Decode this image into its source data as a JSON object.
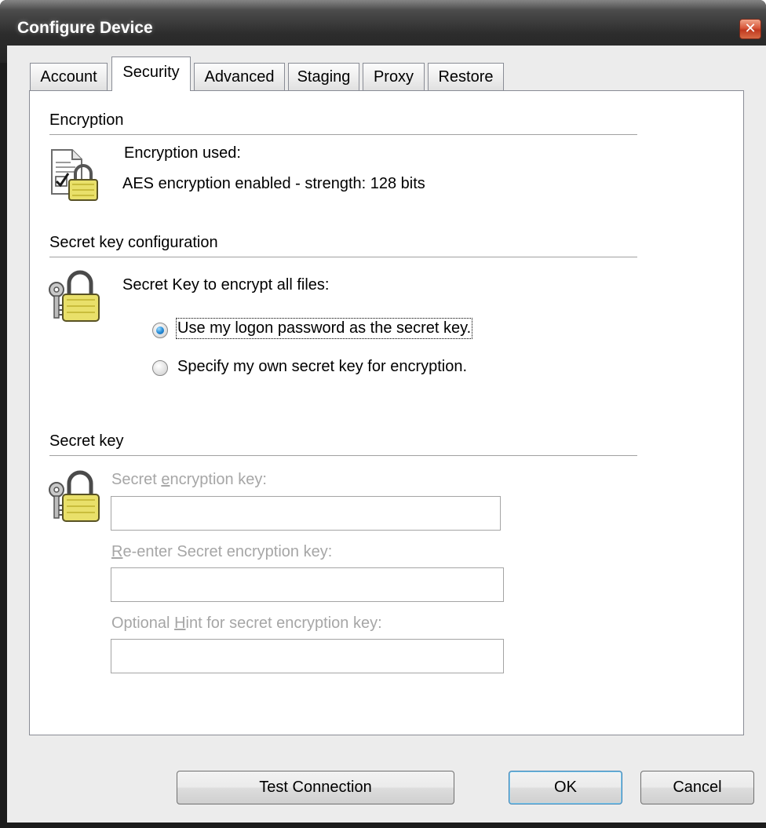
{
  "window": {
    "title": "Configure Device",
    "close_glyph": "✕"
  },
  "tabs": [
    {
      "label": "Account",
      "active": false
    },
    {
      "label": "Security",
      "active": true
    },
    {
      "label": "Advanced",
      "active": false
    },
    {
      "label": "Staging",
      "active": false
    },
    {
      "label": "Proxy",
      "active": false
    },
    {
      "label": "Restore",
      "active": false
    }
  ],
  "encryption": {
    "header": "Encryption",
    "icon": "document-lock-icon",
    "used_label": "Encryption used:",
    "status": "AES encryption enabled - strength: 128 bits"
  },
  "secret_key_config": {
    "header": "Secret key configuration",
    "icon": "keys-lock-icon",
    "prompt": "Secret Key to encrypt all files:",
    "options": [
      {
        "label": "Use my logon password as the secret key.",
        "checked": true
      },
      {
        "label": "Specify my own secret key for encryption.",
        "checked": false
      }
    ]
  },
  "secret_key": {
    "header": "Secret key",
    "icon": "keys-lock-icon",
    "key_label_pre": "Secret ",
    "key_label_accel": "e",
    "key_label_post": "ncryption key:",
    "key_value": "",
    "reenter_label_accel": "R",
    "reenter_label_post": "e-enter Secret encryption key:",
    "reenter_value": "",
    "hint_label_pre": "Optional ",
    "hint_label_accel": "H",
    "hint_label_post": "int for secret encryption key:",
    "hint_value": "",
    "disabled": true
  },
  "buttons": {
    "test_connection": "Test Connection",
    "ok": "OK",
    "cancel": "Cancel"
  },
  "colors": {
    "titlebar": "#2c2c2c",
    "dialog_bg": "#ececec",
    "panel_bg": "#ffffff",
    "disabled_text": "#a6a6a6",
    "lock_yellow": "#e9e06a"
  }
}
